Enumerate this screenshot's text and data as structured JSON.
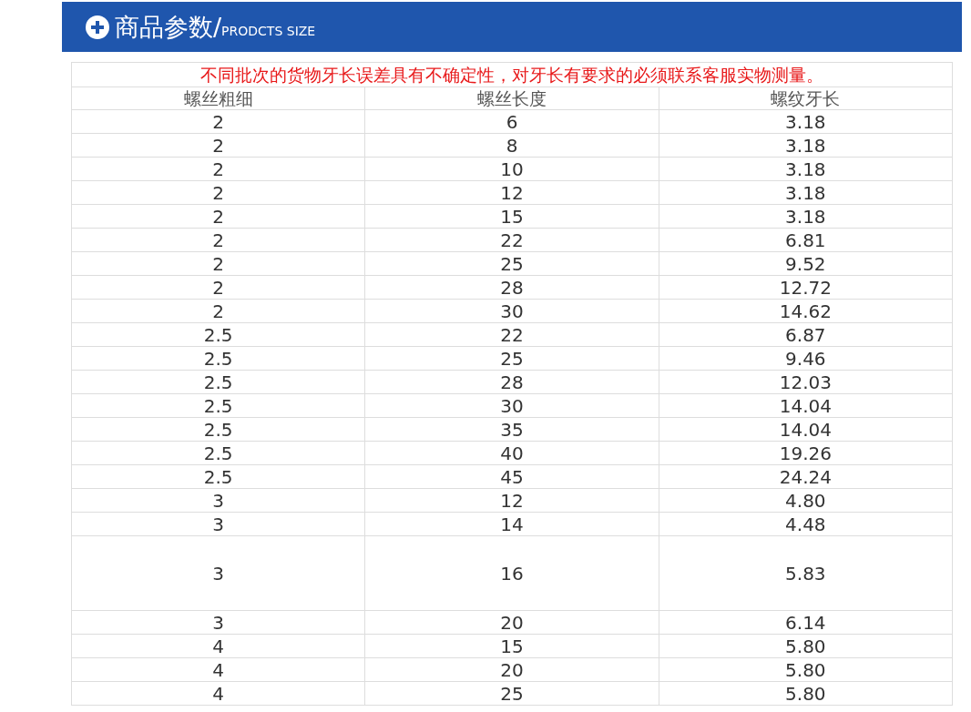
{
  "banner": {
    "title": "商品参数/",
    "subtitle": "PRODCTS SIZE"
  },
  "table": {
    "notice": "不同批次的货物牙长误差具有不确定性，对牙长有要求的必须联系客服实物测量。",
    "columns": [
      "螺丝粗细",
      "螺丝长度",
      "螺纹牙长"
    ],
    "rows": [
      {
        "kind": "normal",
        "cells": [
          "2",
          "6",
          "3.18"
        ]
      },
      {
        "kind": "normal",
        "cells": [
          "2",
          "8",
          "3.18"
        ]
      },
      {
        "kind": "normal",
        "cells": [
          "2",
          "10",
          "3.18"
        ]
      },
      {
        "kind": "normal",
        "cells": [
          "2",
          "12",
          "3.18"
        ]
      },
      {
        "kind": "normal",
        "cells": [
          "2",
          "15",
          "3.18"
        ]
      },
      {
        "kind": "normal",
        "cells": [
          "2",
          "22",
          "6.81"
        ]
      },
      {
        "kind": "normal",
        "cells": [
          "2",
          "25",
          "9.52"
        ]
      },
      {
        "kind": "normal",
        "cells": [
          "2",
          "28",
          "12.72"
        ]
      },
      {
        "kind": "normal",
        "cells": [
          "2",
          "30",
          "14.62"
        ]
      },
      {
        "kind": "normal",
        "cells": [
          "2.5",
          "22",
          "6.87"
        ]
      },
      {
        "kind": "normal",
        "cells": [
          "2.5",
          "25",
          "9.46"
        ]
      },
      {
        "kind": "normal",
        "cells": [
          "2.5",
          "28",
          "12.03"
        ]
      },
      {
        "kind": "normal",
        "cells": [
          "2.5",
          "30",
          "14.04"
        ]
      },
      {
        "kind": "normal",
        "cells": [
          "2.5",
          "35",
          "14.04"
        ]
      },
      {
        "kind": "normal",
        "cells": [
          "2.5",
          "40",
          "19.26"
        ]
      },
      {
        "kind": "normal",
        "cells": [
          "2.5",
          "45",
          "24.24"
        ]
      },
      {
        "kind": "normal",
        "cells": [
          "3",
          "12",
          "4.80"
        ]
      },
      {
        "kind": "normal",
        "cells": [
          "3",
          "14",
          "4.48"
        ]
      },
      {
        "kind": "tall",
        "cells": [
          "3",
          "16",
          "5.83"
        ]
      },
      {
        "kind": "normal",
        "cells": [
          "3",
          "20",
          "6.14"
        ]
      },
      {
        "kind": "normal",
        "cells": [
          "4",
          "15",
          "5.80"
        ]
      },
      {
        "kind": "normal",
        "cells": [
          "4",
          "20",
          "5.80"
        ]
      },
      {
        "kind": "normal",
        "cells": [
          "4",
          "25",
          "5.80"
        ]
      }
    ]
  }
}
